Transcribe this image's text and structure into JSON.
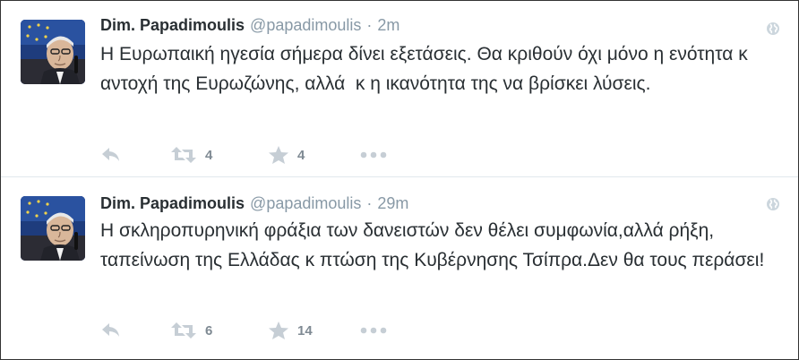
{
  "tweets": [
    {
      "name": "Dim. Papadimoulis",
      "handle": "@papadimoulis",
      "separator": "·",
      "time": "2m",
      "text": "Η Ευρωπαική ηγεσία σήμερα δίνει εξετάσεις. Θα κριθούν όχι μόνο η ενότητα κ αντοχή της Ευρωζώνης, αλλά  κ η ικανότητα της να βρίσκει λύσεις.",
      "retweets": "4",
      "favorites": "4"
    },
    {
      "name": "Dim. Papadimoulis",
      "handle": "@papadimoulis",
      "separator": "·",
      "time": "29m",
      "text": "Η σκληροπυρηνική φράξια των δανειστών δεν θέλει συμφωνία,αλλά ρήξη, ταπείνωση της Ελλάδας κ πτώση της Κυβέρνησης Τσίπρα.Δεν θα τους περάσει!",
      "retweets": "6",
      "favorites": "14"
    }
  ],
  "icons": {
    "reply": "reply-icon",
    "retweet": "retweet-icon",
    "favorite": "star-icon",
    "more": "more-icon",
    "visibility": "globe-icon"
  },
  "colors": {
    "text": "#292f33",
    "muted": "#8899a6",
    "action_icon": "#c6ced5",
    "divider": "#e1e8ed"
  }
}
